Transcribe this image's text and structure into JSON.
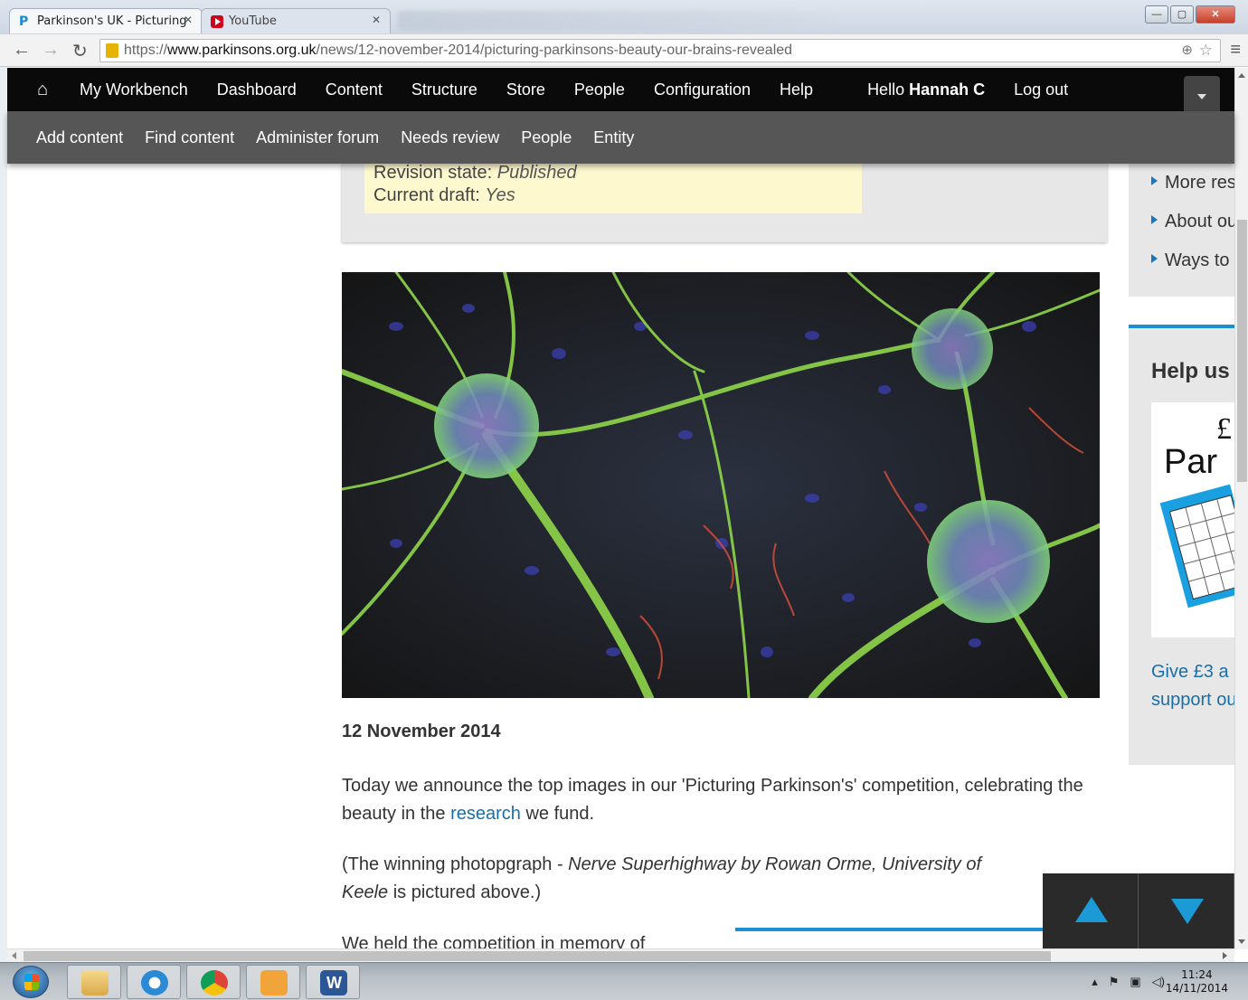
{
  "browser": {
    "tabs": [
      {
        "label": "Parkinson's UK - Picturing",
        "active": true,
        "icon": "parkinsons-logo-icon"
      },
      {
        "label": "YouTube",
        "active": false,
        "icon": "youtube-icon"
      }
    ],
    "url_prefix": "https://",
    "url_domain": "www.parkinsons.org.uk",
    "url_path": "/news/12-november-2014/picturing-parkinsons-beauty-our-brains-revealed"
  },
  "admin_toolbar": {
    "items": [
      "My Workbench",
      "Dashboard",
      "Content",
      "Structure",
      "Store",
      "People",
      "Configuration",
      "Help"
    ],
    "hello": "Hello",
    "user": "Hannah C",
    "logout": "Log out"
  },
  "shortcuts": [
    "Add content",
    "Find content",
    "Administer forum",
    "Needs review",
    "People",
    "Entity"
  ],
  "revision": {
    "state_label": "Revision state:",
    "state_value": "Published",
    "draft_label": "Current draft:",
    "draft_value": "Yes"
  },
  "article": {
    "date": "12 November 2014",
    "p1_before": "Today we announce the top images in our 'Picturing Parkinson's' competition, celebrating the beauty in the ",
    "p1_link": "research",
    "p1_after": " we fund.",
    "p2_before": "(The winning photopgraph - ",
    "p2_italic_1": "Nerve Superhighway by Rowan Orme, University of",
    "p2_italic_2": "Keele",
    "p2_after": " is pictured above.)",
    "p3": "We held the competition in memory of"
  },
  "sidebar": {
    "links": [
      "More res",
      "About ou",
      "Ways to"
    ],
    "help_title": "Help us",
    "help_text_1": "Give £3 a",
    "help_text_2": "support ou",
    "promo_text": "Par",
    "promo_currency": "£"
  },
  "taskbar": {
    "time": "11:24",
    "date": "14/11/2014"
  },
  "colors": {
    "admin_bar": "#0a0a0a",
    "shortcut_bar": "#565656",
    "link": "#1a6ea8",
    "accent": "#1b8fd0"
  }
}
